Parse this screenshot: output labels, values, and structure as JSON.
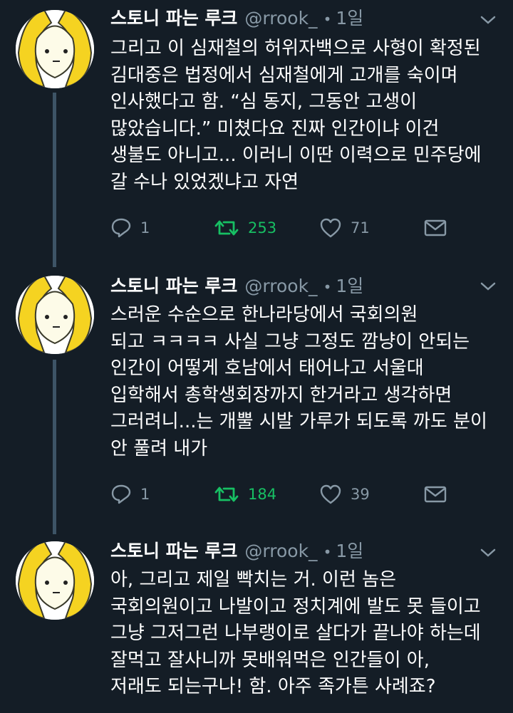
{
  "tweets": [
    {
      "name": "스토니 파는 루크",
      "handle": "@rrook_",
      "separator": "•",
      "time": "1일",
      "lines": [
        "그리고 이 심재철의 허위자백으로 사형이 확정된",
        "김대중은 법정에서 심재철에게 고개를 숙이며",
        "인사했다고 함. “심 동지, 그동안 고생이",
        "많았습니다.” 미쳤다요 진짜 인간이냐 이건",
        "생불도 아니고... 이러니 이딴 이력으로 민주당에",
        "갈 수나 있었겠냐고 자연"
      ],
      "replies": "1",
      "retweets": "253",
      "likes": "71"
    },
    {
      "name": "스토니 파는 루크",
      "handle": "@rrook_",
      "separator": "•",
      "time": "1일",
      "lines": [
        "스러운 수순으로 한나라당에서 국회의원",
        "되고 ㅋㅋㅋㅋ 사실 그냥 그정도 깜냥이 안되는",
        "인간이 어떻게 호남에서  태어나고 서울대",
        "입학해서 총학생회장까지 한거라고 생각하면",
        "그러려니...는 개뿔 시발 가루가 되도록 까도 분이",
        "안 풀려 내가"
      ],
      "replies": "1",
      "retweets": "184",
      "likes": "39"
    },
    {
      "name": "스토니 파는 루크",
      "handle": "@rrook_",
      "separator": "•",
      "time": "1일",
      "lines": [
        "아, 그리고 제일 빡치는 거. 이런 놈은",
        "국회의원이고 나발이고 정치계에 발도 못 들이고",
        "그냥 그저그런 나부랭이로 살다가 끝나야 하는데",
        "잘먹고 잘사니까 못배워먹은 인간들이 아,",
        "저래도 되는구나! 함. 아주 족가튼 사례죠?"
      ]
    }
  ],
  "icons": {
    "reply": "reply-icon",
    "retweet": "retweet-icon",
    "like": "heart-icon",
    "dm": "envelope-icon",
    "more": "chevron-down-icon"
  },
  "colors": {
    "background": "#141d26",
    "secondary": "#8899a6",
    "retweet_green": "#17bf63",
    "thread_line": "#3d5466",
    "avatar_yellow": "#f5d321"
  }
}
